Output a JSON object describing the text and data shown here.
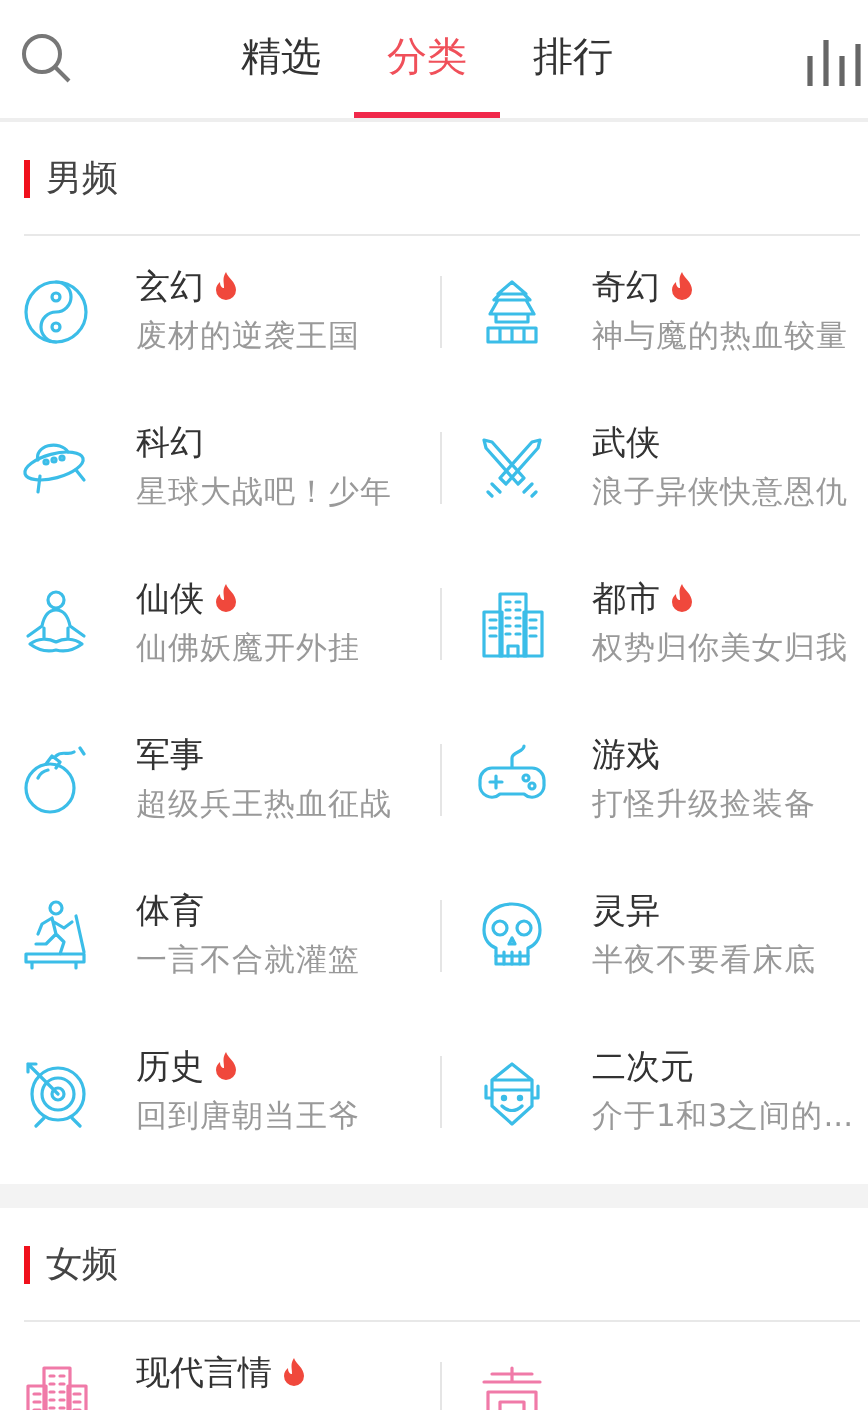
{
  "tabs": [
    {
      "label": "精选",
      "selected": false
    },
    {
      "label": "分类",
      "selected": true
    },
    {
      "label": "排行",
      "selected": false
    }
  ],
  "sections": [
    {
      "title": "男频",
      "items": [
        {
          "title": "玄幻",
          "hot": true,
          "subtitle": "废材的逆袭王国"
        },
        {
          "title": "奇幻",
          "hot": true,
          "subtitle": "神与魔的热血较量"
        },
        {
          "title": "科幻",
          "hot": false,
          "subtitle": "星球大战吧！少年"
        },
        {
          "title": "武侠",
          "hot": false,
          "subtitle": "浪子异侠快意恩仇"
        },
        {
          "title": "仙侠",
          "hot": true,
          "subtitle": "仙佛妖魔开外挂"
        },
        {
          "title": "都市",
          "hot": true,
          "subtitle": "权势归你美女归我"
        },
        {
          "title": "军事",
          "hot": false,
          "subtitle": "超级兵王热血征战"
        },
        {
          "title": "游戏",
          "hot": false,
          "subtitle": "打怪升级捡装备"
        },
        {
          "title": "体育",
          "hot": false,
          "subtitle": "一言不合就灌篮"
        },
        {
          "title": "灵异",
          "hot": false,
          "subtitle": "半夜不要看床底"
        },
        {
          "title": "历史",
          "hot": true,
          "subtitle": "回到唐朝当王爷"
        },
        {
          "title": "二次元",
          "hot": false,
          "subtitle": "介于1和3之间的..."
        }
      ]
    },
    {
      "title": "女频",
      "items": [
        {
          "title": "现代言情",
          "hot": true
        }
      ]
    }
  ]
}
